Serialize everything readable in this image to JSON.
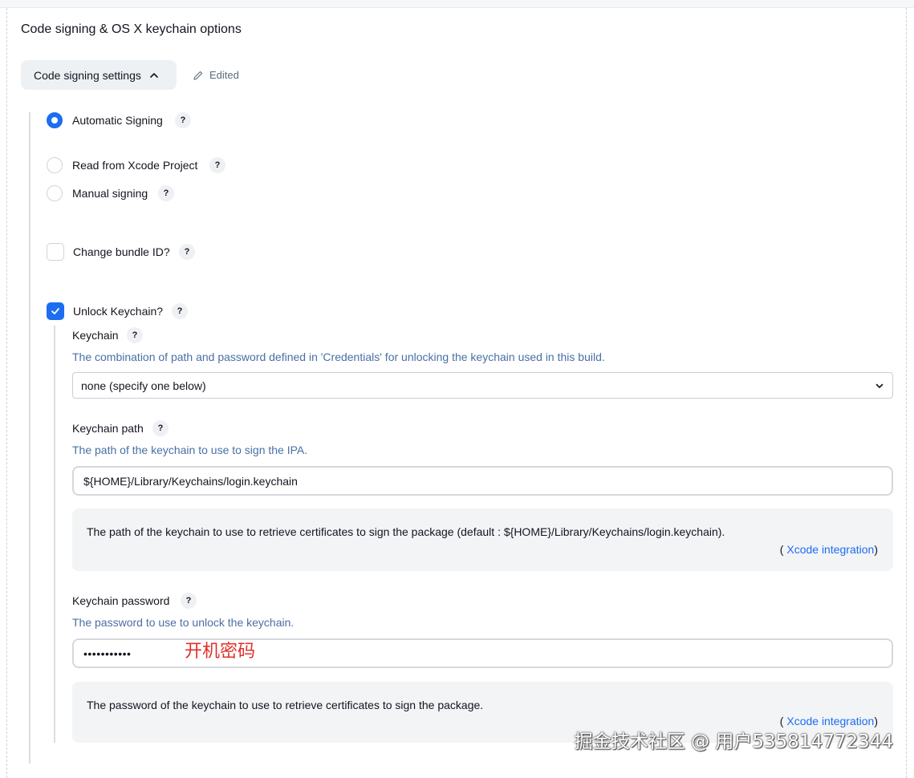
{
  "section": {
    "title": "Code signing & OS X keychain options"
  },
  "settings_button": {
    "label": "Code signing settings"
  },
  "edited_label": "Edited",
  "signing_options": [
    {
      "label": "Automatic Signing",
      "selected": true
    },
    {
      "label": "Read from Xcode Project",
      "selected": false
    },
    {
      "label": "Manual signing",
      "selected": false
    }
  ],
  "change_bundle": {
    "label": "Change bundle ID?",
    "checked": false
  },
  "unlock_keychain": {
    "label": "Unlock Keychain?",
    "checked": true
  },
  "keychain": {
    "label": "Keychain",
    "description": "The combination of path and password defined in 'Credentials' for unlocking the keychain used in this build.",
    "selected": "none (specify one below)"
  },
  "keychain_path": {
    "label": "Keychain path",
    "description": "The path of the keychain to use to sign the IPA.",
    "value": "${HOME}/Library/Keychains/login.keychain",
    "info": "The path of the keychain to use to retrieve certificates to sign the package (default : ${HOME}/Library/Keychains/login.keychain).",
    "link_open": "( ",
    "link_text": "Xcode integration",
    "link_close": ")"
  },
  "keychain_password": {
    "label": "Keychain password",
    "description": "The password to use to unlock the keychain.",
    "value": "•••••••••••",
    "info": "The password of the keychain to use to retrieve certificates to sign the package.",
    "link_open": "( ",
    "link_text": "Xcode integration",
    "link_close": ")"
  },
  "help_glyph": "?",
  "annotation": "开机密码",
  "watermark": "掘金技术社区 @ 用户535814772344",
  "colors": {
    "accent": "#1d6df0",
    "description": "#4a6fa5",
    "annotation": "#e0302a"
  }
}
